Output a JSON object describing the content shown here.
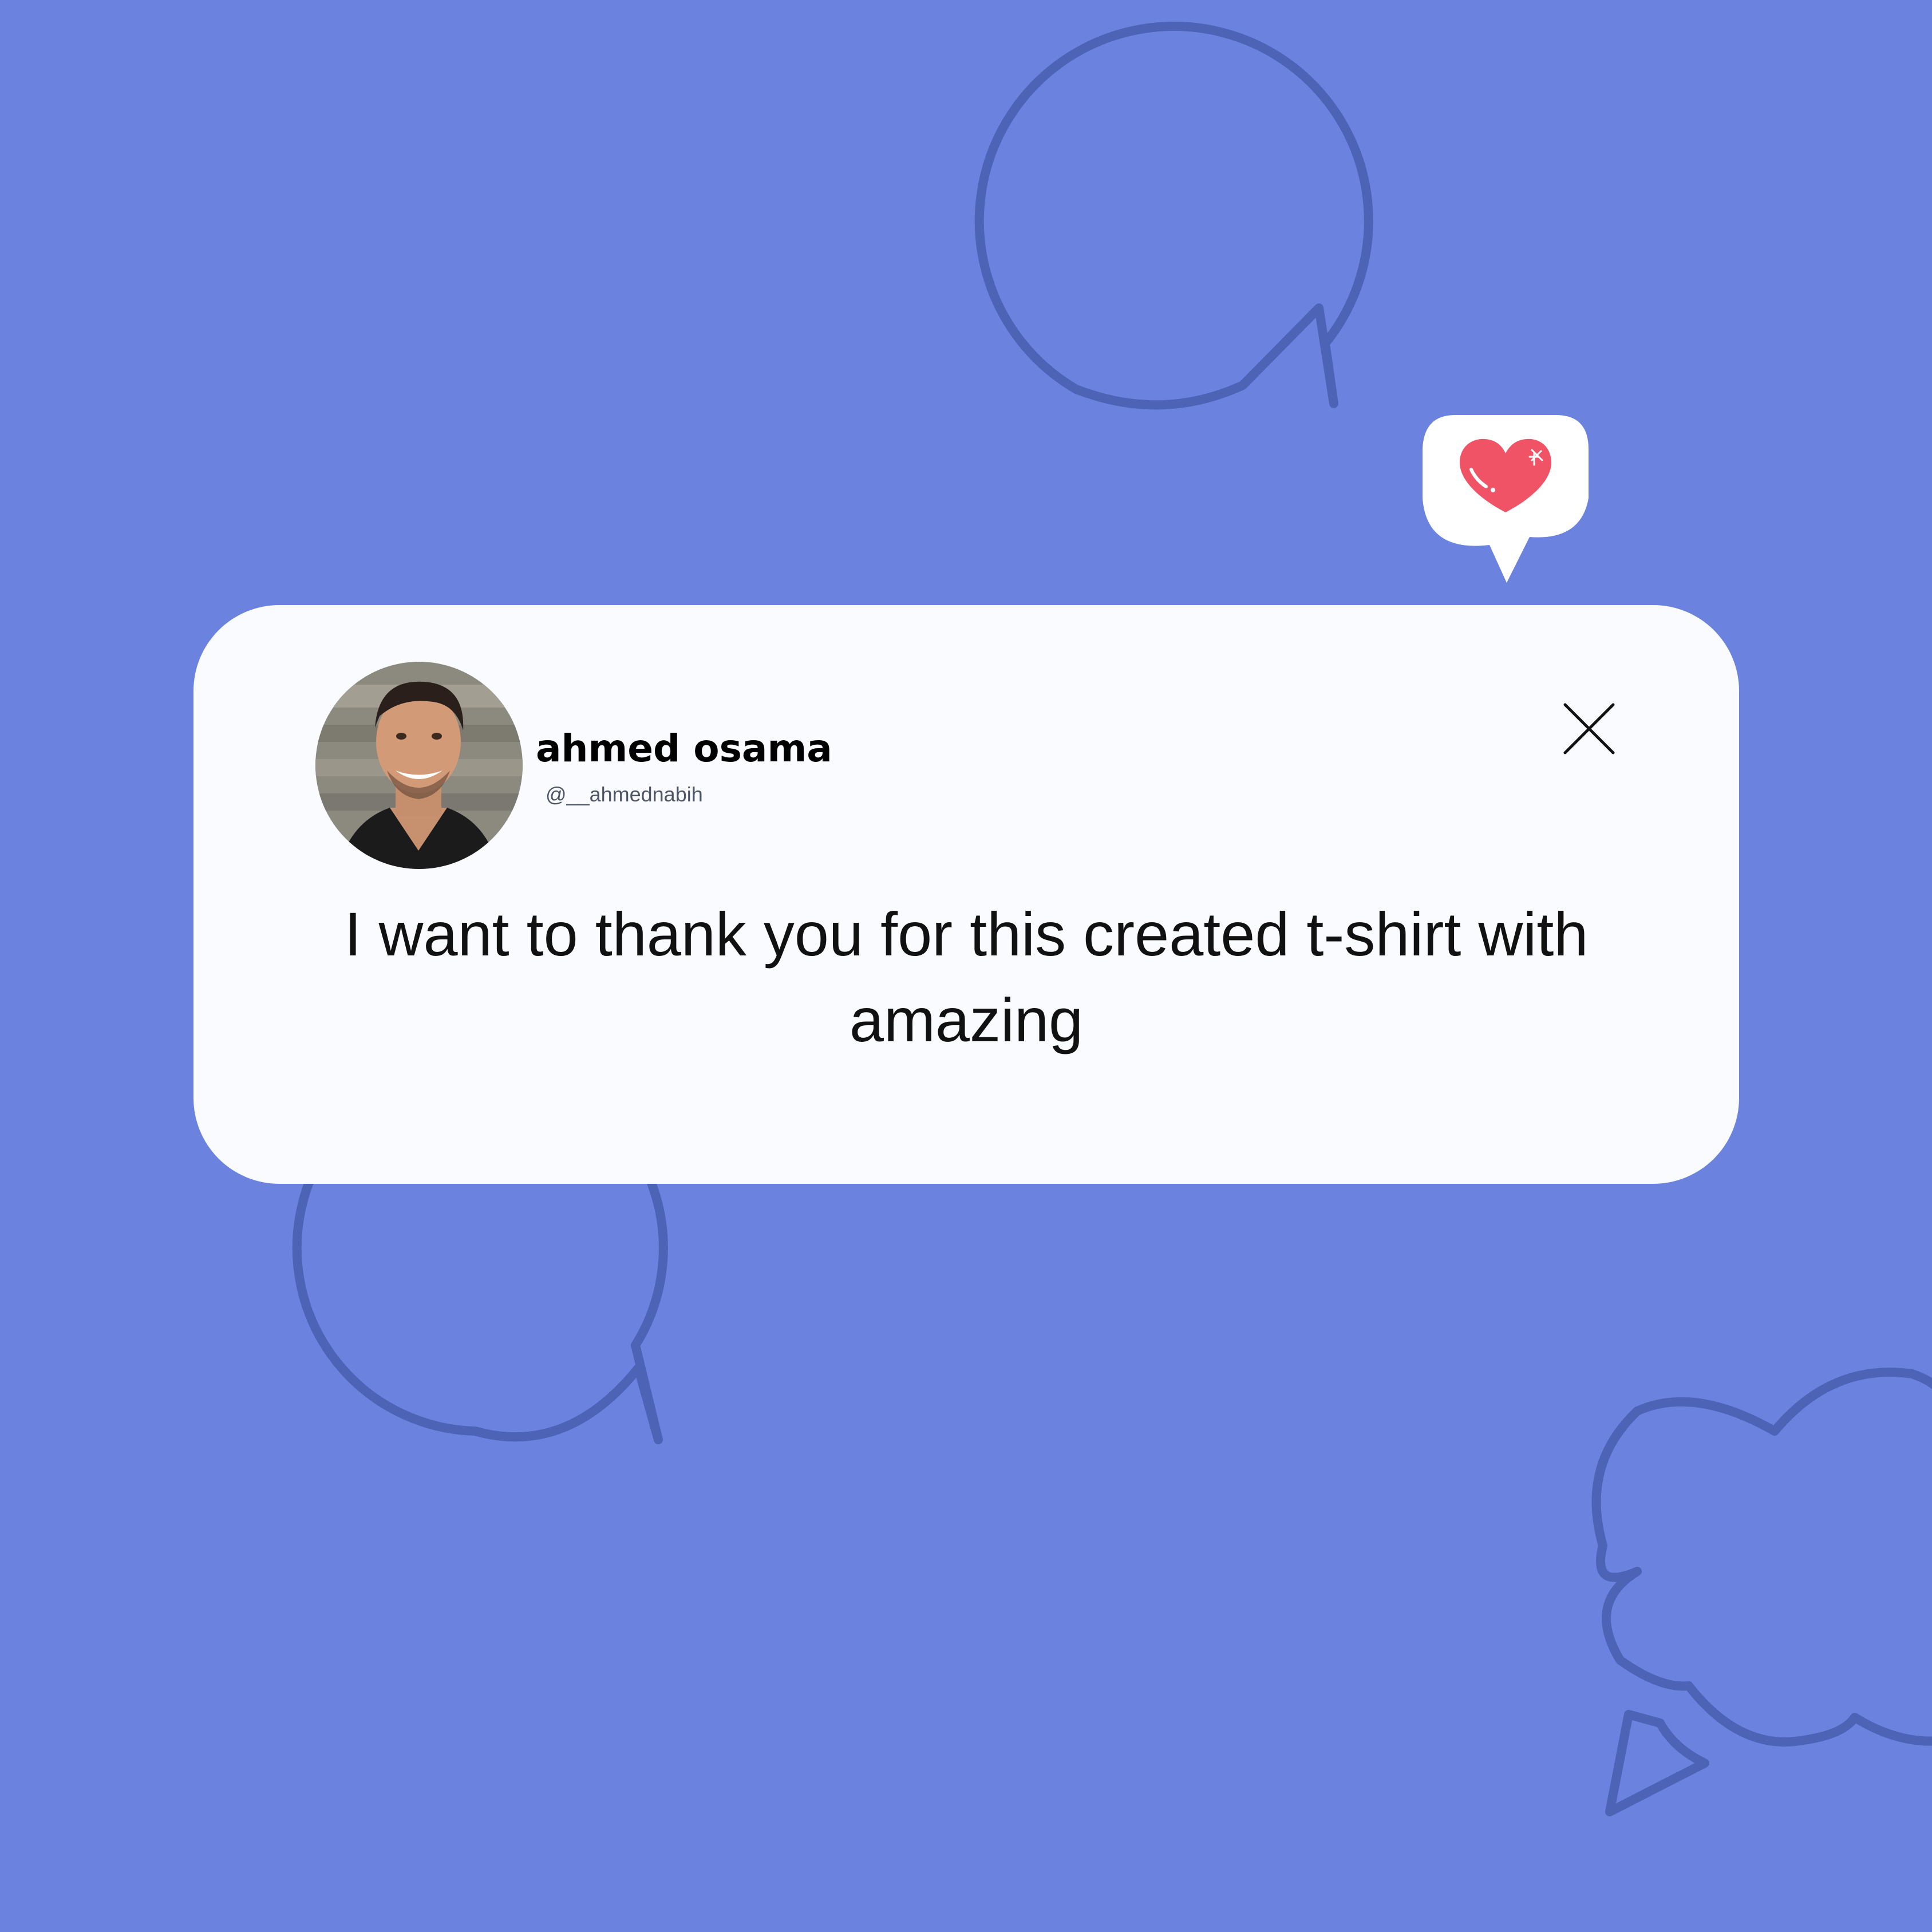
{
  "colors": {
    "background": "#6b83df",
    "outline": "#4c63b6",
    "card": "#f9fbff",
    "heart": "#f05365"
  },
  "post": {
    "author_name": "ahmed osama",
    "author_handle": "@__ahmednabih",
    "message": "I want to thank you for this created t-shirt with amazing"
  },
  "icons": {
    "close": "close-icon",
    "heart": "heart-icon",
    "avatar": "profile-photo"
  }
}
